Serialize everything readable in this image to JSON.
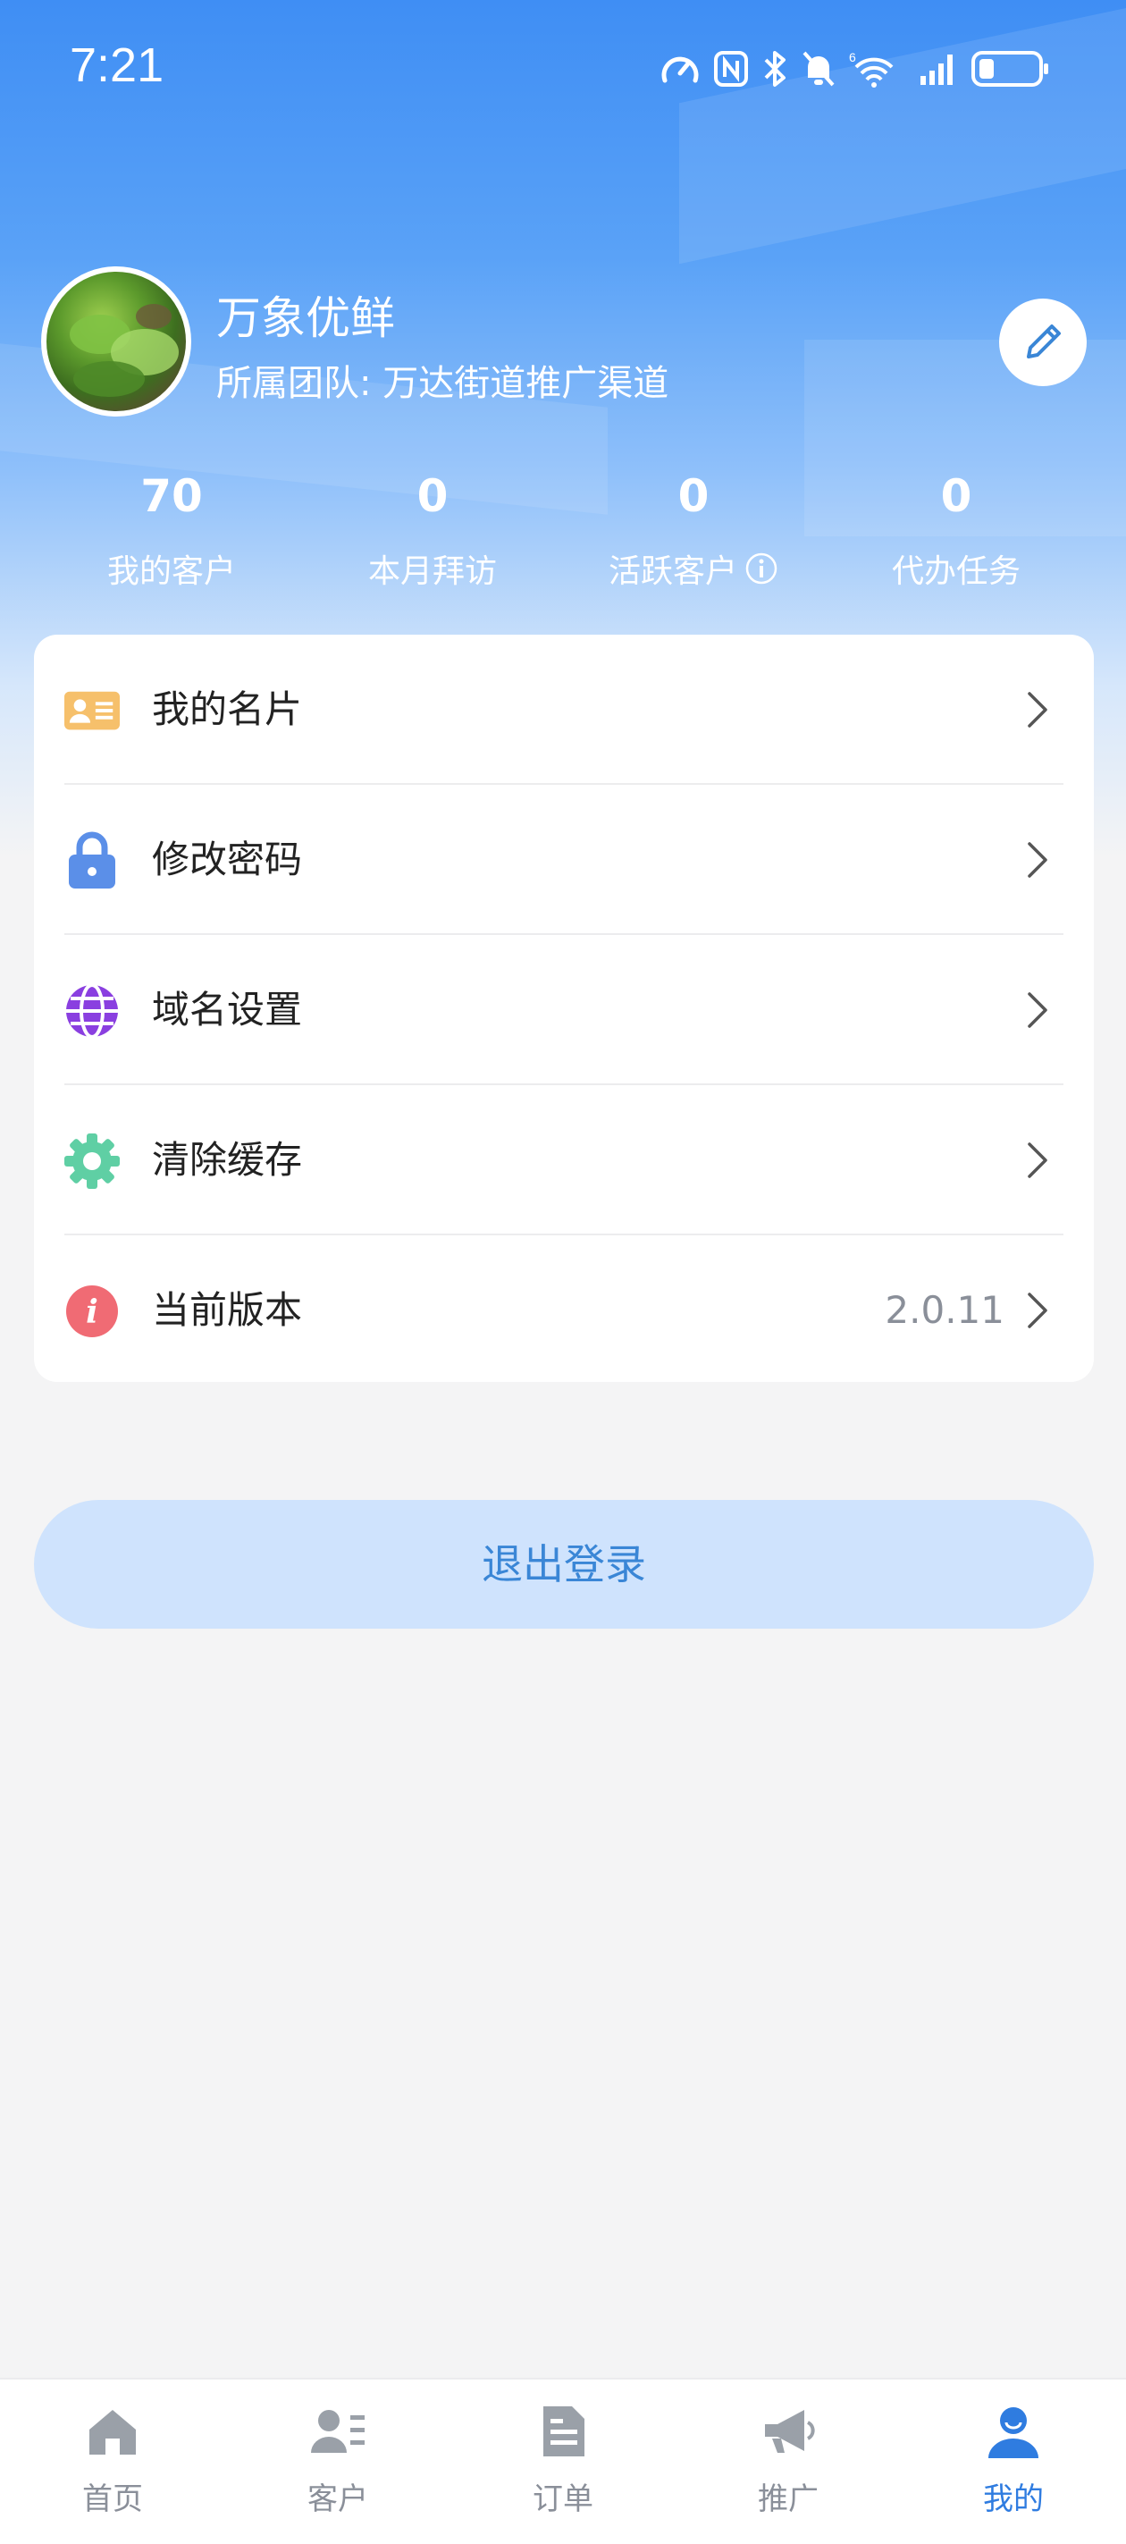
{
  "status_bar": {
    "time": "7:21",
    "icons": [
      "speedometer-icon",
      "nfc-icon",
      "bluetooth-icon",
      "bell-muted-icon",
      "wifi-icon",
      "signal-icon",
      "battery-icon"
    ]
  },
  "profile": {
    "name": "万象优鲜",
    "team": "所属团队: 万达街道推广渠道",
    "avatar_icon": "avatar-photo"
  },
  "stats": [
    {
      "value": "70",
      "label": "我的客户"
    },
    {
      "value": "0",
      "label": "本月拜访"
    },
    {
      "value": "0",
      "label": "活跃客户"
    },
    {
      "value": "0",
      "label": "代办任务"
    }
  ],
  "menu": {
    "items": [
      {
        "label": "我的名片",
        "icon": "business-card-icon",
        "value": ""
      },
      {
        "label": "修改密码",
        "icon": "lock-icon",
        "value": ""
      },
      {
        "label": "域名设置",
        "icon": "globe-icon",
        "value": ""
      },
      {
        "label": "清除缓存",
        "icon": "gear-icon",
        "value": ""
      },
      {
        "label": "当前版本",
        "icon": "info-icon",
        "value": "2.0.11"
      }
    ]
  },
  "logout_label": "退出登录",
  "tabbar": {
    "tabs": [
      {
        "label": "首页",
        "icon": "home-icon"
      },
      {
        "label": "客户",
        "icon": "customers-icon"
      },
      {
        "label": "订单",
        "icon": "order-icon"
      },
      {
        "label": "推广",
        "icon": "megaphone-icon"
      },
      {
        "label": "我的",
        "icon": "profile-icon"
      }
    ],
    "active_index": 4
  },
  "colors": {
    "header_blue": "#3f8ef4",
    "accent": "#2f7ce0",
    "logout_bg": "#cfe3fd",
    "card_icon": "#f6c06b",
    "lock_icon": "#5b8fe8",
    "globe_icon": "#8a3fe0",
    "gear_icon": "#5fcfa4",
    "info_icon": "#f06b74"
  }
}
